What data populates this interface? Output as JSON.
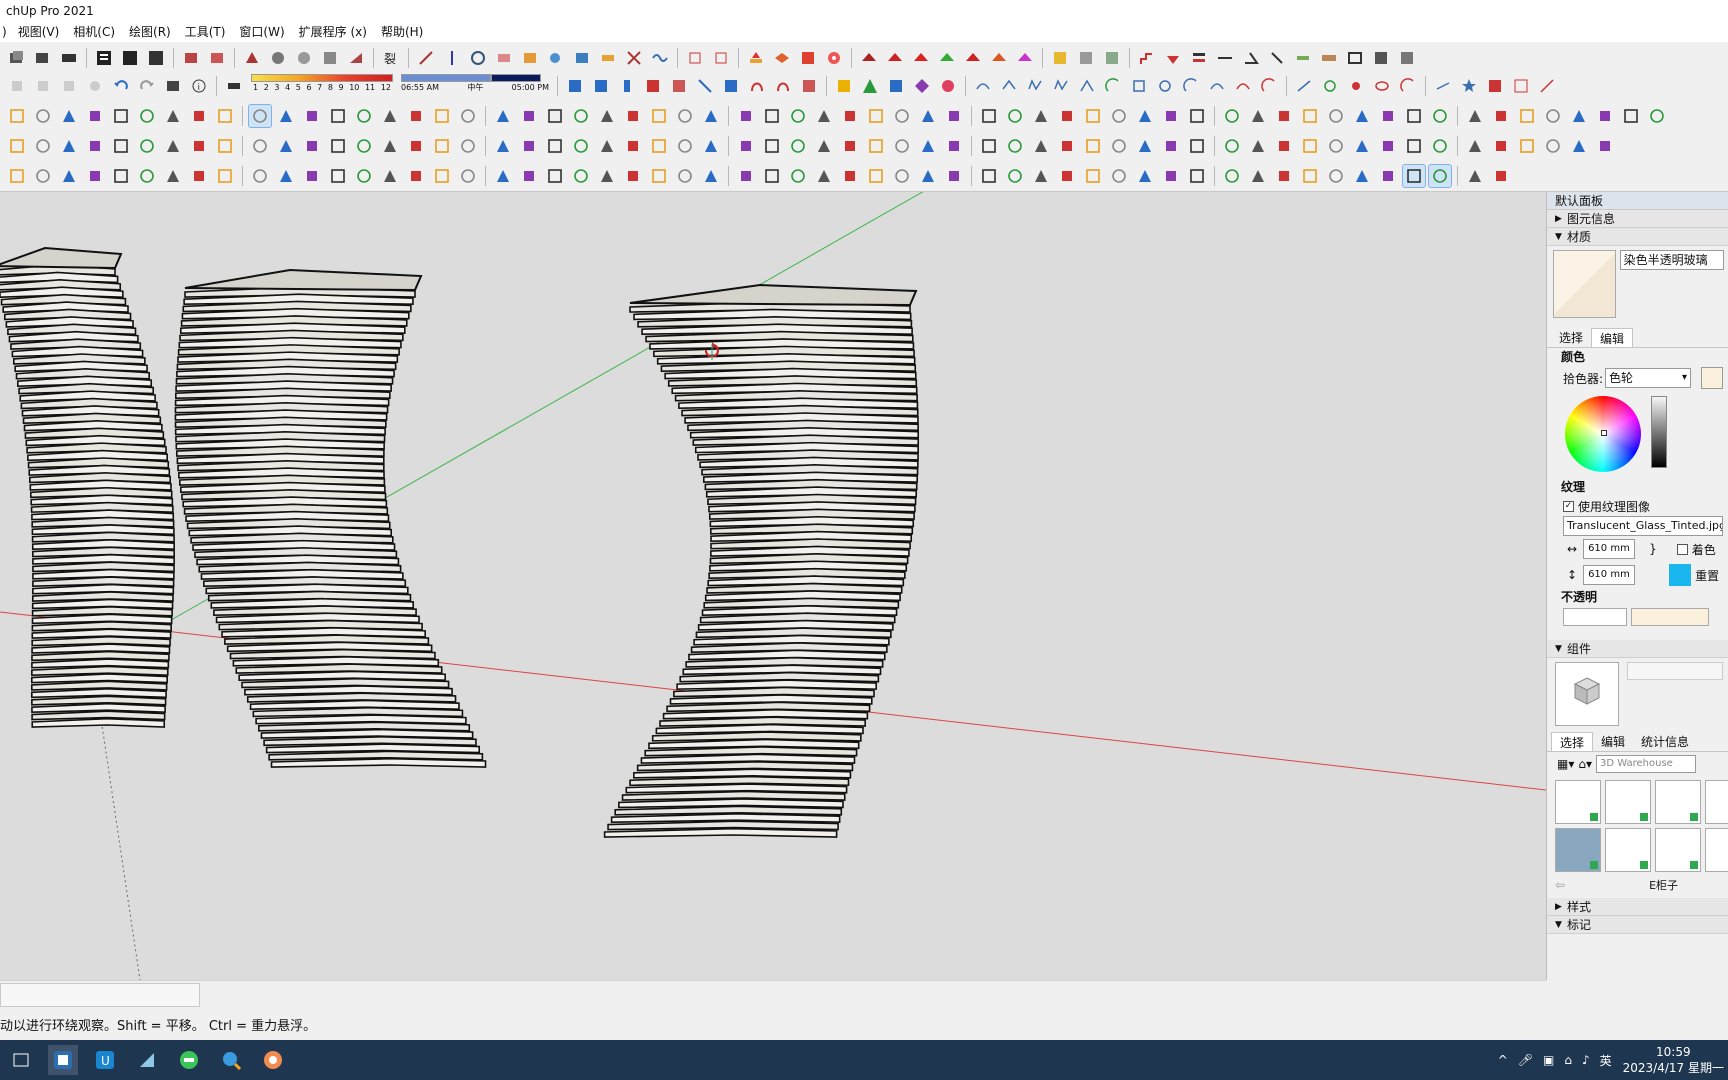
{
  "window": {
    "title": "chUp Pro 2021"
  },
  "menu": [
    "视图(V)",
    "相机(C)",
    "绘图(R)",
    "工具(T)",
    "窗口(W)",
    "扩展程序 (x)",
    "帮助(H)"
  ],
  "toolbar": {
    "shadow_numbers": [
      "1",
      "2",
      "3",
      "4",
      "5",
      "6",
      "7",
      "8",
      "9",
      "10",
      "11",
      "12"
    ],
    "time_start": "06:55 AM",
    "time_mid": "中午",
    "time_end": "05:00 PM"
  },
  "panel": {
    "title": "默认面板",
    "sections": {
      "entity_info": "图元信息",
      "materials": "材质",
      "components": "组件",
      "styles": "样式",
      "tags": "标记"
    },
    "material_name": "染色半透明玻璃",
    "tabs": {
      "select": "选择",
      "edit": "编辑"
    },
    "color_label": "颜色",
    "picker_label": "拾色器:",
    "picker_value": "色轮",
    "texture_label": "纹理",
    "use_texture_label": "使用纹理图像",
    "texture_file": "Translucent_Glass_Tinted.jpg",
    "width": "610 mm",
    "height": "610 mm",
    "colorize_label": "着色",
    "reset_label": "重置",
    "opacity_label": "不透明",
    "comp_tabs": {
      "select": "选择",
      "edit": "编辑",
      "stats": "统计信息"
    },
    "search_placeholder": "3D Warehouse",
    "component_caption": "E柜子"
  },
  "status": {
    "hint": "动以进行环绕观察。Shift = 平移。 Ctrl = 重力悬浮。"
  },
  "taskbar": {
    "ime": "英",
    "time": "10:59",
    "date": "2023/4/17 星期一"
  }
}
